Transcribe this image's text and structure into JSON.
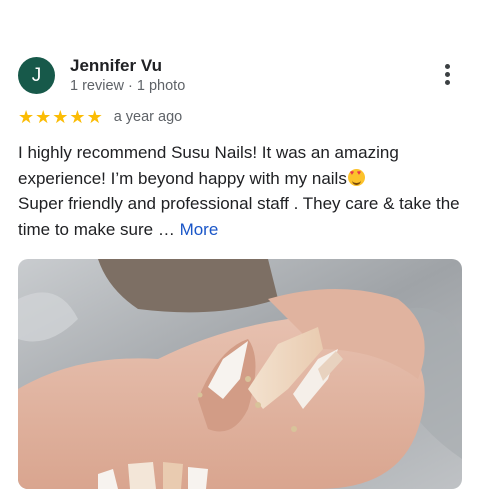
{
  "review": {
    "reviewer": {
      "initial": "J",
      "name": "Jennifer Vu",
      "review_count": "1 review",
      "separator": " · ",
      "photo_count": "1 photo",
      "avatar_color": "#17594a"
    },
    "menu_icon": "more-vert-icon",
    "rating": 5,
    "star_glyph": "★",
    "star_color": "#fbbc04",
    "time_ago": "a year ago",
    "text_line1": "I highly recommend Susu Nails! It was an amazing experience! I’m beyond happy with my nails",
    "text_line2": "Super friendly and professional staff . They care & take the time to make sure … ",
    "more_label": "More",
    "link_color": "#1a56c8",
    "emoji_icon": "heart-eyes-emoji-icon",
    "photo": "review-photo-nails"
  }
}
